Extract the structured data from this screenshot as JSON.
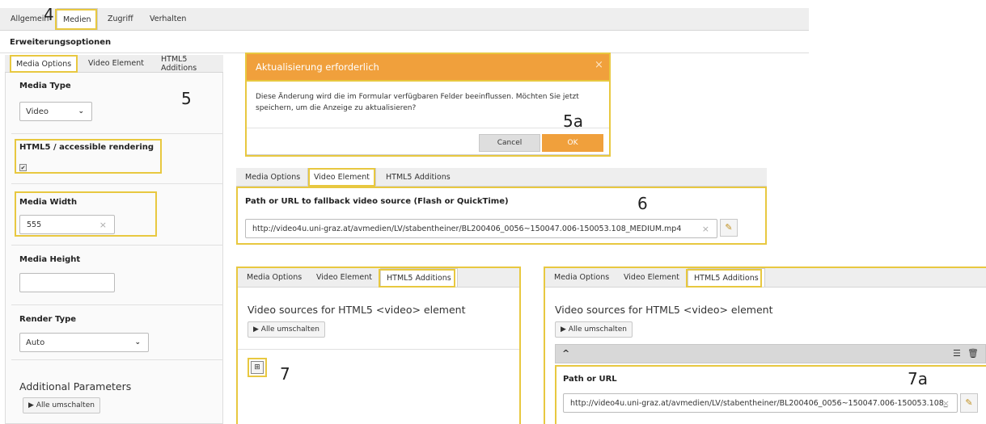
{
  "top_tabs": [
    "Allgemein",
    "Medien",
    "Zugriff",
    "Verhalten"
  ],
  "section_title": "Erweiterungsoptionen",
  "sub_tabs": [
    "Media Options",
    "Video Element",
    "HTML5 Additions"
  ],
  "left_panel": {
    "media_type_label": "Media Type",
    "media_type_value": "Video",
    "html5_label": "HTML5 / accessible rendering",
    "media_width_label": "Media Width",
    "media_width_value": "555",
    "media_height_label": "Media Height",
    "render_type_label": "Render Type",
    "render_type_value": "Auto",
    "additional_params_label": "Additional Parameters",
    "toggle_all_label": "▶ Alle umschalten"
  },
  "dialog": {
    "title": "Aktualisierung erforderlich",
    "close": "×",
    "message": "Diese Änderung wird die im Formular verfügbaren Felder beeinflussen. Möchten Sie jetzt speichern, um die Anzeige zu aktualisieren?",
    "cancel_label": "Cancel",
    "ok_label": "OK"
  },
  "video_element_panel": {
    "field_label": "Path or URL to fallback video source (Flash or QuickTime)",
    "field_value": "http://video4u.uni-graz.at/avmedien/LV/stabentheiner/BL200406_0056~150047.006-150053.108_MEDIUM.mp4"
  },
  "html5_panel_a": {
    "heading": "Video sources for HTML5 <video> element",
    "toggle_all_label": "▶ Alle umschalten"
  },
  "html5_panel_b": {
    "heading": "Video sources for HTML5 <video> element",
    "toggle_all_label": "▶ Alle umschalten",
    "item_toggle": "^",
    "path_label": "Path or URL",
    "path_value": "http://video4u.uni-graz.at/avmedien/LV/stabentheiner/BL200406_0056~150047.006-150053.108_"
  },
  "callouts": {
    "c4": "4",
    "c5": "5",
    "c5a": "5a",
    "c6": "6",
    "c7": "7",
    "c7a": "7a"
  },
  "colors": {
    "highlight": "#e8c840",
    "dialog_header": "#f0a03c",
    "ok_button": "#f0a03c"
  }
}
